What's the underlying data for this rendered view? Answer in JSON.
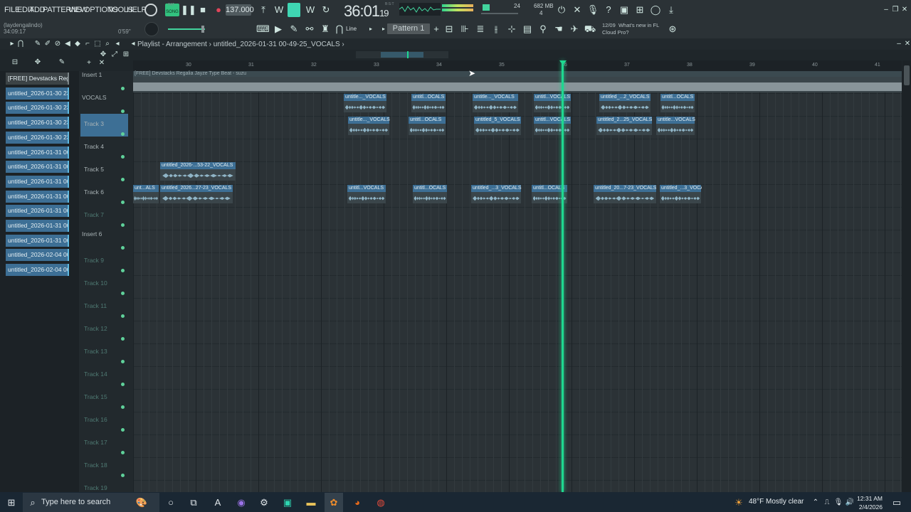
{
  "menu": [
    "FILE",
    "EDIT",
    "ADD",
    "PATTERNS",
    "VIEW",
    "OPTIONS",
    "TOOLS",
    "HELP"
  ],
  "transport": {
    "mode": "SONG",
    "mode_alt": "PAT",
    "bpm": "137.000",
    "song_time": "36:01",
    "song_time_small": "19",
    "time_caption": "B:S:T"
  },
  "cpu": {
    "cpu_value": "24",
    "memory": "682 MB",
    "poly": "4"
  },
  "hint": {
    "user": "(laydengalindo)",
    "time": "34:09:17",
    "delay": "0'59\""
  },
  "snap": "Line",
  "pattern": "Pattern 1",
  "news": {
    "date": "12/09",
    "headline": "What's new in FL",
    "sub": "Cloud Pro?"
  },
  "breadcrumb": {
    "prefix": "Playlist - Arrangement",
    "project": "untitled_2026-01-31 00-49-25_VOCALS"
  },
  "browser_items": [
    "[FREE] Devstacks  Regali...",
    "untitled_2026-01-30 23-...",
    "untitled_2026-01-30 23-...",
    "untitled_2026-01-30 23-...",
    "untitled_2026-01-30 23-...",
    "untitled_2026-01-31 00-...",
    "untitled_2026-01-31 00-...",
    "untitled_2026-01-31 00-...",
    "untitled_2026-01-31 00-...",
    "untitled_2026-01-31 00-...",
    "untitled_2026-01-31 00-...",
    "untitled_2026-01-31 00-...",
    "untitled_2026-02-04 00-...",
    "untitled_2026-02-04 00-..."
  ],
  "ruler": [
    "30",
    "31",
    "32",
    "33",
    "34",
    "35",
    "36",
    "37",
    "38",
    "39",
    "40",
    "41"
  ],
  "tracks": [
    {
      "name": "Insert 1",
      "insert": true
    },
    {
      "name": "VOCALS",
      "insert": true,
      "selected": true
    },
    {
      "name": "Track 3"
    },
    {
      "name": "Track 4"
    },
    {
      "name": "Track 5"
    },
    {
      "name": "Track 6"
    },
    {
      "name": "Track 7",
      "dim": true
    },
    {
      "name": "Insert 6",
      "insert": true
    },
    {
      "name": "Track 9",
      "dim": true
    },
    {
      "name": "Track 10",
      "dim": true
    },
    {
      "name": "Track 11",
      "dim": true
    },
    {
      "name": "Track 12",
      "dim": true
    },
    {
      "name": "Track 13",
      "dim": true
    },
    {
      "name": "Track 14",
      "dim": true
    },
    {
      "name": "Track 15",
      "dim": true
    },
    {
      "name": "Track 16",
      "dim": true
    },
    {
      "name": "Track 17",
      "dim": true
    },
    {
      "name": "Track 18",
      "dim": true
    },
    {
      "name": "Track 19",
      "dim": true
    }
  ],
  "insert_clip": "[FREE] Devstacks  Regalia  Jayze Type Beat - suzu",
  "clips": [
    {
      "row": 1,
      "label": "untitle..._VOCALS"
    },
    {
      "row": 1,
      "label": "untitl...OCALS"
    },
    {
      "row": 1,
      "label": "untitle..._VOCALS"
    },
    {
      "row": 1,
      "label": "untitl...VOCALS"
    },
    {
      "row": 1,
      "label": "untitled_...2_VOCALS"
    },
    {
      "row": 1,
      "label": "untitl...OCALS"
    },
    {
      "row": 2,
      "label": "untitle..._VOCALS"
    },
    {
      "row": 2,
      "label": "untitl...OCALS"
    },
    {
      "row": 2,
      "label": "untitled_5_VOCALS"
    },
    {
      "row": 2,
      "label": "untitl...VOCALS"
    },
    {
      "row": 2,
      "label": "untitled_2...25_VOCALS"
    },
    {
      "row": 2,
      "label": "untitle...VOCALS"
    },
    {
      "row": 4,
      "label": "untitled_2026-...53-22_VOCALS"
    },
    {
      "row": 5,
      "label": "unt...ALS"
    },
    {
      "row": 5,
      "label": "untitled_2026...27-23_VOCALS"
    },
    {
      "row": 5,
      "label": "untitl...VOCALS"
    },
    {
      "row": 5,
      "label": "untitl...OCALS"
    },
    {
      "row": 5,
      "label": "untitled_...3_VOCALS"
    },
    {
      "row": 5,
      "label": "untitl...OCALS"
    },
    {
      "row": 5,
      "label": "untitled_20...7-23_VOCALS"
    },
    {
      "row": 5,
      "label": "untitled_...3_VOCALS"
    }
  ],
  "taskbar": {
    "search_placeholder": "Type here to search",
    "weather": "48°F  Mostly clear",
    "time": "12:31 AM",
    "date": "2/4/2026"
  },
  "accent": "#1fd890",
  "clip_color": "#3d6f95"
}
